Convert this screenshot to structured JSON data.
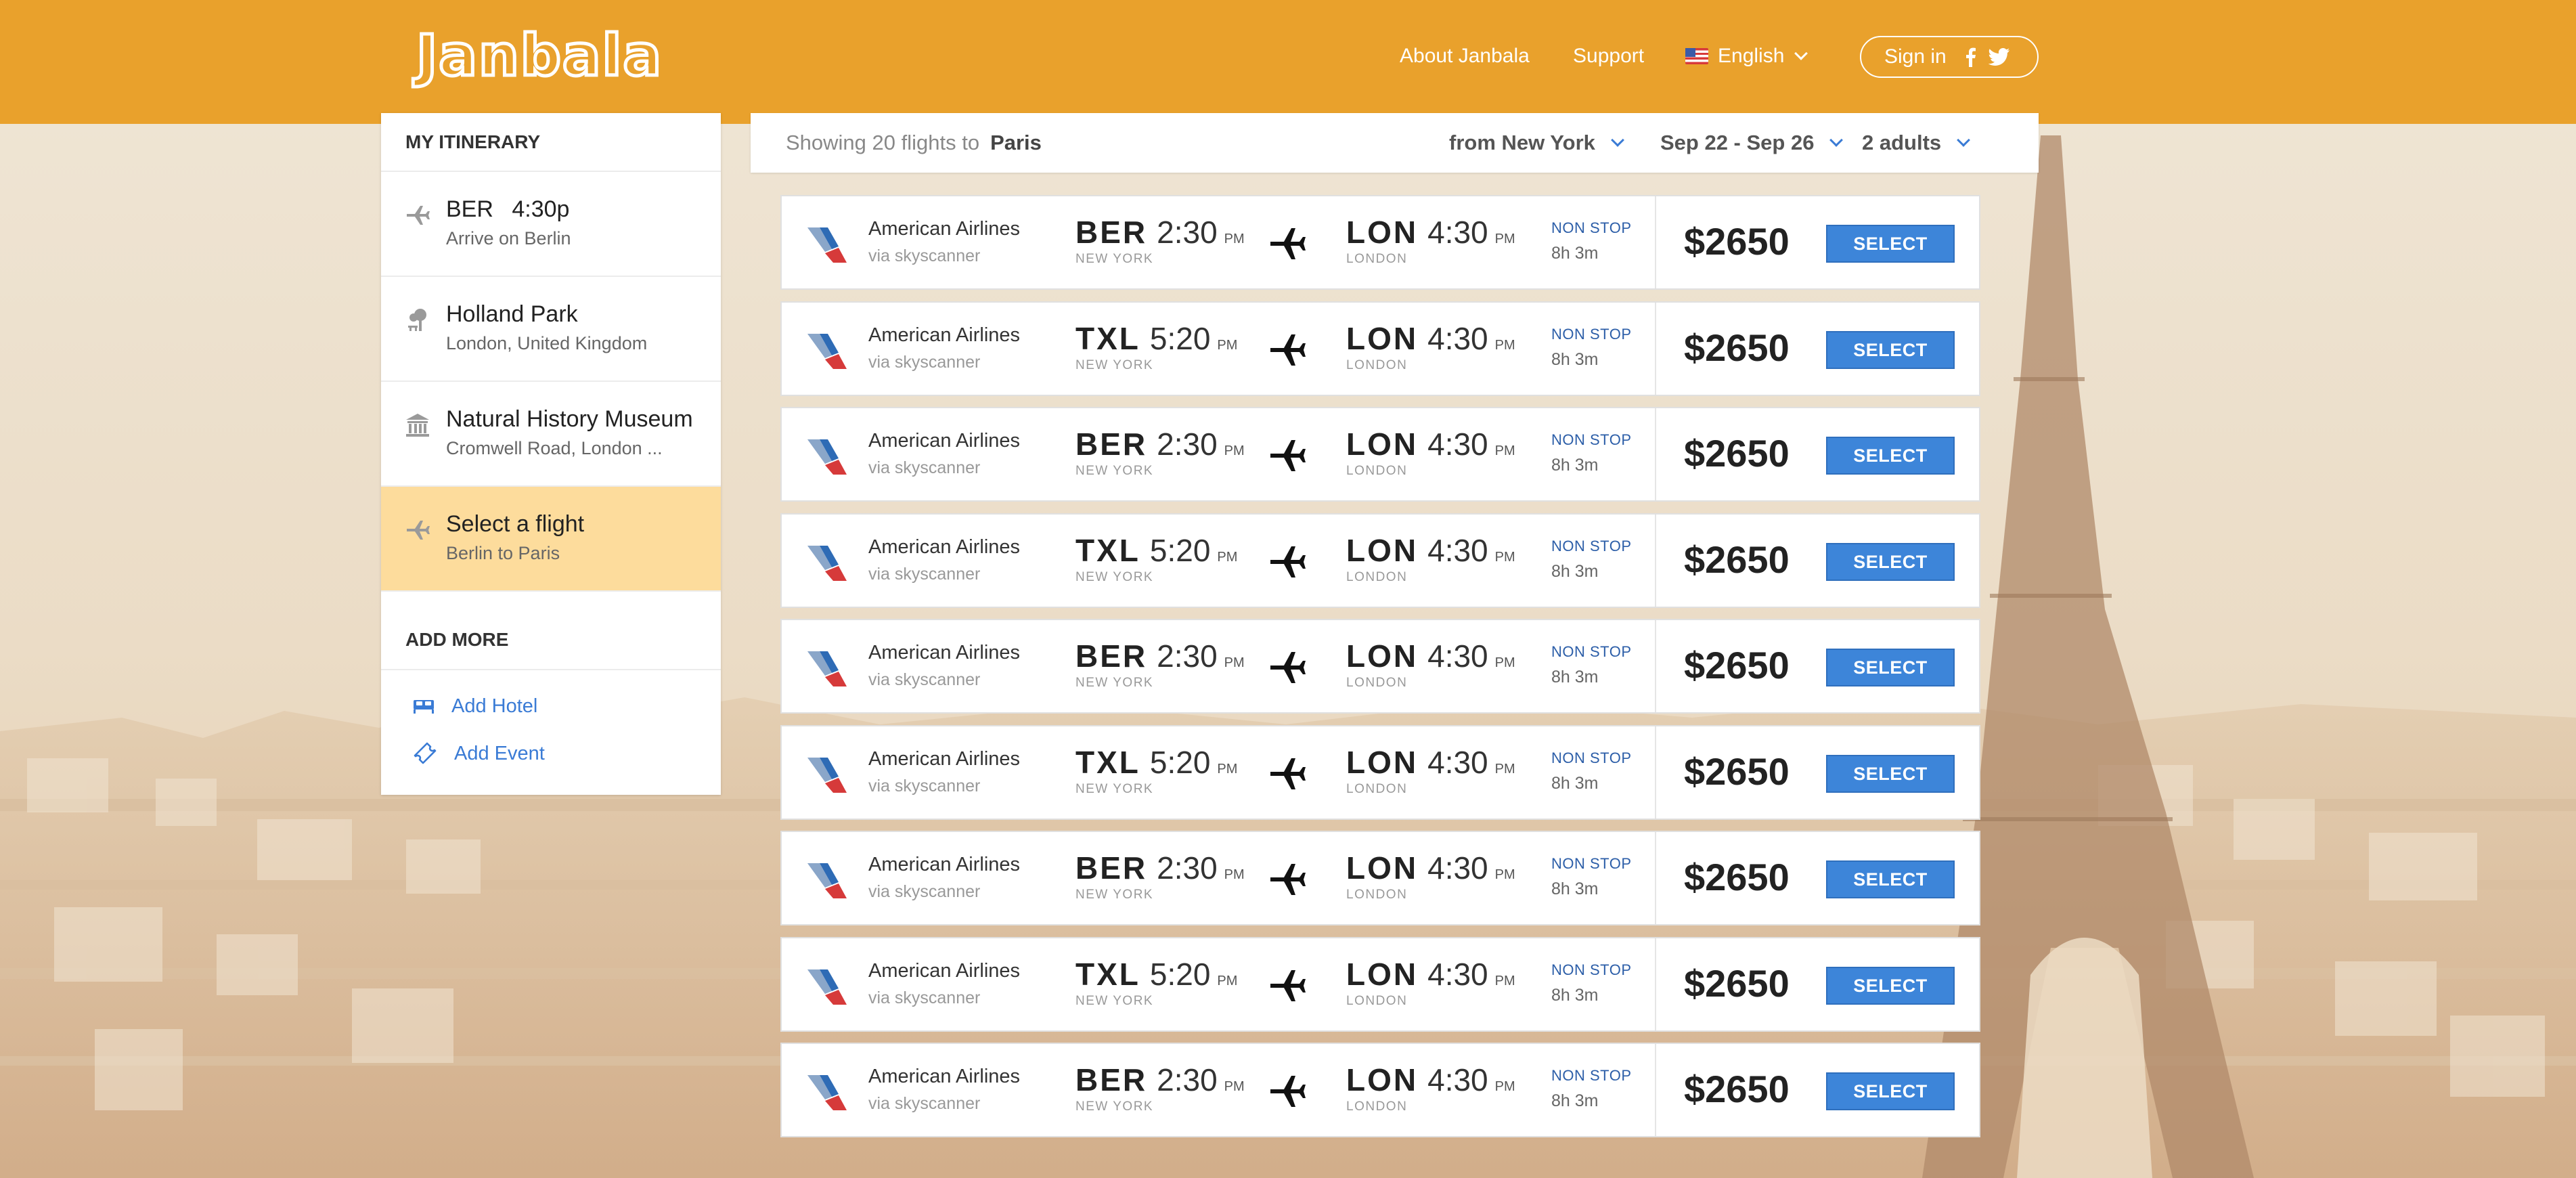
{
  "brand": {
    "logo": "Janbala",
    "header_color": "#e9a12c",
    "accent": "#3d85d9"
  },
  "nav": {
    "about": "About Janbala",
    "support": "Support",
    "language": "English",
    "signin": "Sign in",
    "social_icons": [
      "facebook-icon",
      "twitter-icon"
    ]
  },
  "sidebar": {
    "title": "MY ITINERARY",
    "items": [
      {
        "icon": "plane-icon",
        "code": "BER",
        "time": "4:30p",
        "subtitle": "Arrive on Berlin"
      },
      {
        "icon": "park-icon",
        "title": "Holland Park",
        "subtitle": "London, United Kingdom"
      },
      {
        "icon": "museum-icon",
        "title": "Natural History Museum",
        "subtitle": "Cromwell Road, London ..."
      },
      {
        "icon": "plane-icon",
        "title": "Select a flight",
        "subtitle": "Berlin to Paris",
        "active": true
      }
    ],
    "add_more_title": "ADD MORE",
    "add_hotel": "Add Hotel",
    "add_event": "Add Event"
  },
  "search": {
    "showing": "Showing 20 flights to",
    "destination": "Paris",
    "from": "from New York",
    "dates": "Sep 22 - Sep 26",
    "travelers": "2 adults"
  },
  "flights": [
    {
      "airline": "American Airlines",
      "via": "via skyscanner",
      "dep_code": "BER",
      "dep_time": "2:30",
      "dep_ampm": "PM",
      "dep_city": "NEW YORK",
      "arr_code": "LON",
      "arr_time": "4:30",
      "arr_ampm": "PM",
      "arr_city": "LONDON",
      "stops": "NON STOP",
      "duration": "8h 3m",
      "price": "$2650",
      "button": "SELECT"
    },
    {
      "airline": "American Airlines",
      "via": "via skyscanner",
      "dep_code": "TXL",
      "dep_time": "5:20",
      "dep_ampm": "PM",
      "dep_city": "NEW YORK",
      "arr_code": "LON",
      "arr_time": "4:30",
      "arr_ampm": "PM",
      "arr_city": "LONDON",
      "stops": "NON STOP",
      "duration": "8h 3m",
      "price": "$2650",
      "button": "SELECT"
    },
    {
      "airline": "American Airlines",
      "via": "via skyscanner",
      "dep_code": "BER",
      "dep_time": "2:30",
      "dep_ampm": "PM",
      "dep_city": "NEW YORK",
      "arr_code": "LON",
      "arr_time": "4:30",
      "arr_ampm": "PM",
      "arr_city": "LONDON",
      "stops": "NON STOP",
      "duration": "8h 3m",
      "price": "$2650",
      "button": "SELECT"
    },
    {
      "airline": "American Airlines",
      "via": "via skyscanner",
      "dep_code": "TXL",
      "dep_time": "5:20",
      "dep_ampm": "PM",
      "dep_city": "NEW YORK",
      "arr_code": "LON",
      "arr_time": "4:30",
      "arr_ampm": "PM",
      "arr_city": "LONDON",
      "stops": "NON STOP",
      "duration": "8h 3m",
      "price": "$2650",
      "button": "SELECT"
    },
    {
      "airline": "American Airlines",
      "via": "via skyscanner",
      "dep_code": "BER",
      "dep_time": "2:30",
      "dep_ampm": "PM",
      "dep_city": "NEW YORK",
      "arr_code": "LON",
      "arr_time": "4:30",
      "arr_ampm": "PM",
      "arr_city": "LONDON",
      "stops": "NON STOP",
      "duration": "8h 3m",
      "price": "$2650",
      "button": "SELECT"
    },
    {
      "airline": "American Airlines",
      "via": "via skyscanner",
      "dep_code": "TXL",
      "dep_time": "5:20",
      "dep_ampm": "PM",
      "dep_city": "NEW YORK",
      "arr_code": "LON",
      "arr_time": "4:30",
      "arr_ampm": "PM",
      "arr_city": "LONDON",
      "stops": "NON STOP",
      "duration": "8h 3m",
      "price": "$2650",
      "button": "SELECT"
    },
    {
      "airline": "American Airlines",
      "via": "via skyscanner",
      "dep_code": "BER",
      "dep_time": "2:30",
      "dep_ampm": "PM",
      "dep_city": "NEW YORK",
      "arr_code": "LON",
      "arr_time": "4:30",
      "arr_ampm": "PM",
      "arr_city": "LONDON",
      "stops": "NON STOP",
      "duration": "8h 3m",
      "price": "$2650",
      "button": "SELECT"
    },
    {
      "airline": "American Airlines",
      "via": "via skyscanner",
      "dep_code": "TXL",
      "dep_time": "5:20",
      "dep_ampm": "PM",
      "dep_city": "NEW YORK",
      "arr_code": "LON",
      "arr_time": "4:30",
      "arr_ampm": "PM",
      "arr_city": "LONDON",
      "stops": "NON STOP",
      "duration": "8h 3m",
      "price": "$2650",
      "button": "SELECT"
    },
    {
      "airline": "American Airlines",
      "via": "via skyscanner",
      "dep_code": "BER",
      "dep_time": "2:30",
      "dep_ampm": "PM",
      "dep_city": "NEW YORK",
      "arr_code": "LON",
      "arr_time": "4:30",
      "arr_ampm": "PM",
      "arr_city": "LONDON",
      "stops": "NON STOP",
      "duration": "8h 3m",
      "price": "$2650",
      "button": "SELECT"
    }
  ]
}
